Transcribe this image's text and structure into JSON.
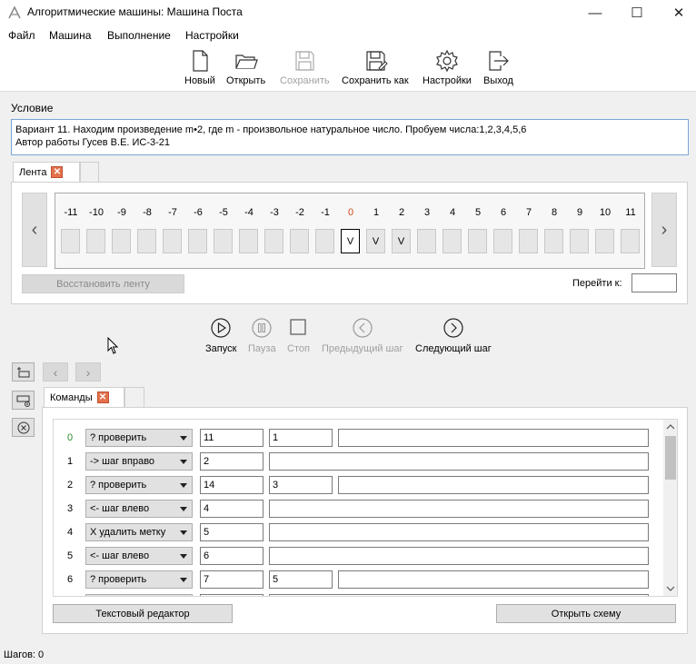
{
  "window": {
    "title": "Алгоритмические машины: Машина Поста",
    "minimize": "—",
    "maximize": "☐",
    "close": "✕"
  },
  "menu": [
    "Файл",
    "Машина",
    "Выполнение",
    "Настройки"
  ],
  "toolbar": {
    "new": "Новый",
    "open": "Открыть",
    "save": "Сохранить",
    "save_as": "Сохранить как",
    "settings": "Настройки",
    "exit": "Выход"
  },
  "condition": {
    "label": "Условие",
    "line1": "Вариант  11. Находим произведение m•2, где m  - произвольное натуральное число. Пробуем числа:1,2,3,4,5,6",
    "line2": "Автор работы Гусев В.Е. ИС-3-21"
  },
  "tape": {
    "tab_label": "Лента",
    "cells": [
      {
        "index": "-11",
        "mark": ""
      },
      {
        "index": "-10",
        "mark": ""
      },
      {
        "index": "-9",
        "mark": ""
      },
      {
        "index": "-8",
        "mark": ""
      },
      {
        "index": "-7",
        "mark": ""
      },
      {
        "index": "-6",
        "mark": ""
      },
      {
        "index": "-5",
        "mark": ""
      },
      {
        "index": "-4",
        "mark": ""
      },
      {
        "index": "-3",
        "mark": ""
      },
      {
        "index": "-2",
        "mark": ""
      },
      {
        "index": "-1",
        "mark": ""
      },
      {
        "index": "0",
        "mark": "V",
        "current": true
      },
      {
        "index": "1",
        "mark": "V"
      },
      {
        "index": "2",
        "mark": "V"
      },
      {
        "index": "3",
        "mark": ""
      },
      {
        "index": "4",
        "mark": ""
      },
      {
        "index": "5",
        "mark": ""
      },
      {
        "index": "6",
        "mark": ""
      },
      {
        "index": "7",
        "mark": ""
      },
      {
        "index": "8",
        "mark": ""
      },
      {
        "index": "9",
        "mark": ""
      },
      {
        "index": "10",
        "mark": ""
      },
      {
        "index": "11",
        "mark": ""
      }
    ],
    "restore_button": "Восстановить ленту",
    "goto_label": "Перейти к:",
    "goto_value": ""
  },
  "run": {
    "start": "Запуск",
    "pause": "Пауза",
    "stop": "Стоп",
    "prev_step": "Предыдущий шаг",
    "next_step": "Следующий шаг"
  },
  "commands": {
    "tab_label": "Команды",
    "rows": [
      {
        "num": "0",
        "op": "? проверить",
        "next1": "11",
        "next2": "1",
        "comment": ""
      },
      {
        "num": "1",
        "op": "-> шаг вправо",
        "next1": "2",
        "next2": null,
        "comment": ""
      },
      {
        "num": "2",
        "op": "? проверить",
        "next1": "14",
        "next2": "3",
        "comment": ""
      },
      {
        "num": "3",
        "op": "<- шаг влево",
        "next1": "4",
        "next2": null,
        "comment": ""
      },
      {
        "num": "4",
        "op": "X удалить метку",
        "next1": "5",
        "next2": null,
        "comment": ""
      },
      {
        "num": "5",
        "op": "<- шаг влево",
        "next1": "6",
        "next2": null,
        "comment": ""
      },
      {
        "num": "6",
        "op": "? проверить",
        "next1": "7",
        "next2": "5",
        "comment": ""
      }
    ],
    "text_editor_button": "Текстовый редактор",
    "open_scheme_button": "Открыть схему"
  },
  "status": {
    "steps_label": "Шагов: 0"
  },
  "colors": {
    "accent_zero": "#d04a1a",
    "active_row": "#2d8a2d",
    "tab_close": "#e4704c"
  }
}
